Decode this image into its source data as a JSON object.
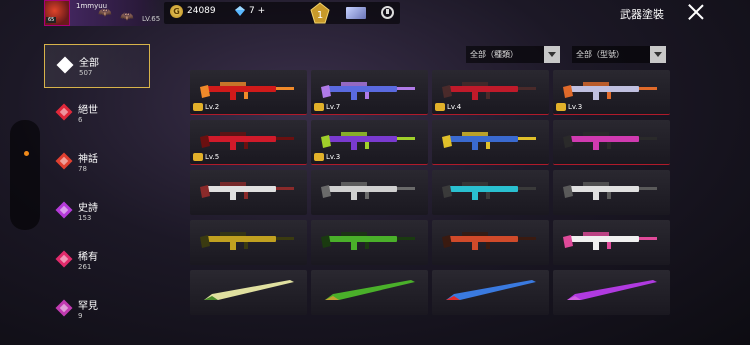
{
  "player": {
    "name": "1mmyuu",
    "level_label": "LV.65",
    "avatar_level": "65"
  },
  "resources": {
    "coins": "24089",
    "diamonds": "7 +"
  },
  "header": {
    "title": "武器塗裝",
    "rank_number": "1"
  },
  "icons": {
    "coin": "coin-icon",
    "diamond": "diamond-icon",
    "rank": "rank-emblem-icon",
    "card": "card-icon",
    "settings": "settings-icon",
    "close": "close-icon"
  },
  "filters": {
    "type": "全部（種類）",
    "model": "全部（型號）"
  },
  "categories": [
    {
      "label": "全部",
      "count": "507",
      "color": "#ffffff"
    },
    {
      "label": "絕世",
      "count": "6",
      "color": "#e0283a"
    },
    {
      "label": "神話",
      "count": "78",
      "color": "#e04030"
    },
    {
      "label": "史詩",
      "count": "153",
      "color": "#b43ad8"
    },
    {
      "label": "稀有",
      "count": "261",
      "color": "#e02a6a"
    },
    {
      "label": "罕見",
      "count": "9",
      "color": "#c03ab0"
    }
  ],
  "weapons": [
    {
      "level": "Lv.2",
      "colors": [
        "#d01a1a",
        "#f08a2a"
      ]
    },
    {
      "level": "Lv.7",
      "colors": [
        "#5a6ae0",
        "#b07ae8"
      ]
    },
    {
      "level": "Lv.4",
      "colors": [
        "#c01a2a",
        "#4a2a2a"
      ]
    },
    {
      "level": "Lv.3",
      "colors": [
        "#c0c0e0",
        "#e06a2a"
      ]
    },
    {
      "level": "Lv.5",
      "colors": [
        "#d01a2a",
        "#6a1010"
      ]
    },
    {
      "level": "Lv.3",
      "colors": [
        "#7a3ad0",
        "#a0d02a"
      ]
    },
    {
      "level": "",
      "colors": [
        "#3a6ad0",
        "#e0c02a"
      ]
    },
    {
      "level": "",
      "colors": [
        "#d03ab0",
        "#2a2a2a"
      ]
    },
    {
      "level": "",
      "colors": [
        "#e0e0e0",
        "#8a2a2a"
      ]
    },
    {
      "level": "",
      "colors": [
        "#d0d0d0",
        "#6a6a6a"
      ]
    },
    {
      "level": "",
      "colors": [
        "#2ac0d0",
        "#3a3a3a"
      ]
    },
    {
      "level": "",
      "colors": [
        "#e0e0e0",
        "#5a5a5a"
      ]
    },
    {
      "level": "",
      "colors": [
        "#c0a020",
        "#3a3a10"
      ]
    },
    {
      "level": "",
      "colors": [
        "#4ab02a",
        "#1a3a10"
      ]
    },
    {
      "level": "",
      "colors": [
        "#d04a2a",
        "#3a1a10"
      ]
    },
    {
      "level": "",
      "colors": [
        "#f0f0f0",
        "#e04a9a"
      ]
    },
    {
      "level": "",
      "colors": [
        "#e0e0a0",
        "#4a8a2a"
      ]
    },
    {
      "level": "",
      "colors": [
        "#4ab02a",
        "#c0a030"
      ]
    },
    {
      "level": "",
      "colors": [
        "#3a7ae0",
        "#e02a2a"
      ]
    },
    {
      "level": "",
      "colors": [
        "#b03ae0",
        "#d060e0"
      ]
    }
  ]
}
